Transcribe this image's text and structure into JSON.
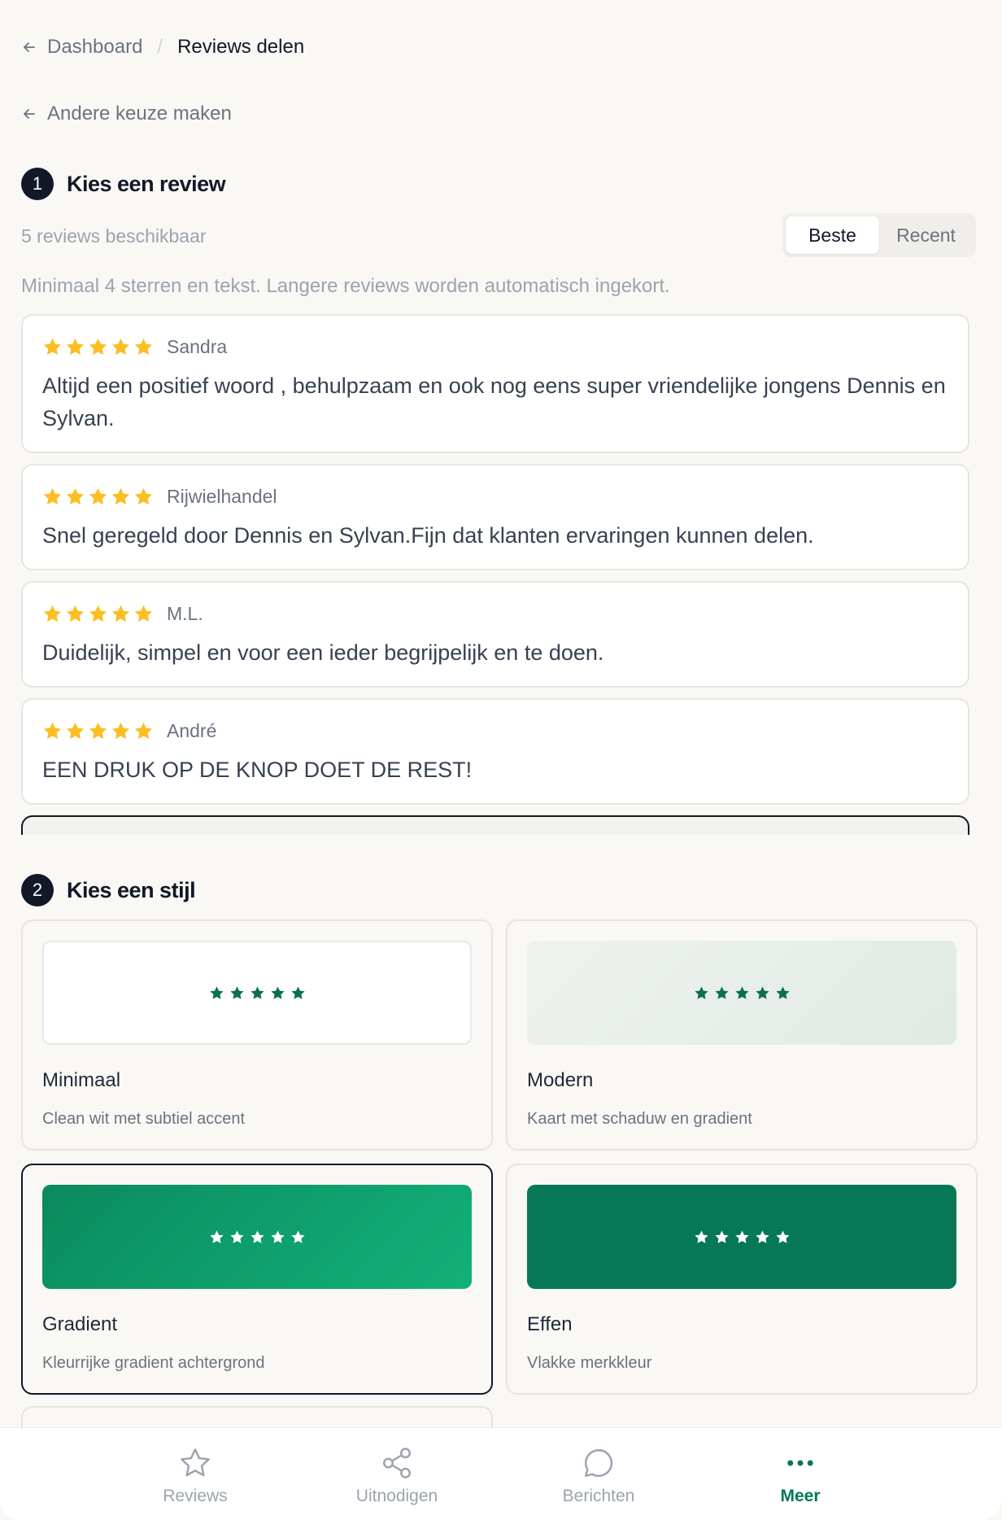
{
  "breadcrumb": {
    "back": "Dashboard",
    "separator": "/",
    "current": "Reviews delen"
  },
  "back_choice": "Andere keuze maken",
  "step1": {
    "number": "1",
    "title": "Kies een review"
  },
  "available": "5 reviews beschikbaar",
  "sort": {
    "options": [
      "Beste",
      "Recent"
    ],
    "active": "Beste"
  },
  "hint": "Minimaal 4 sterren en tekst. Langere reviews worden automatisch ingekort.",
  "reviews": [
    {
      "author": "Sandra",
      "rating": 5,
      "text": "Altijd een positief woord , behulpzaam en ook nog eens super vriendelijke jongens Dennis en Sylvan."
    },
    {
      "author": "Rijwielhandel",
      "rating": 5,
      "text": "Snel geregeld door Dennis en Sylvan.Fijn dat klanten ervaringen kunnen delen."
    },
    {
      "author": "M.L.",
      "rating": 5,
      "text": "Duidelijk, simpel en voor een ieder begrijpelijk en te doen."
    },
    {
      "author": "André",
      "rating": 5,
      "text": "EEN DRUK OP DE KNOP DOET DE REST!"
    }
  ],
  "step2": {
    "number": "2",
    "title": "Kies een stijl"
  },
  "styles": [
    {
      "name": "Minimaal",
      "desc": "Clean wit met subtiel accent"
    },
    {
      "name": "Modern",
      "desc": "Kaart met schaduw en gradient"
    },
    {
      "name": "Gradient",
      "desc": "Kleurrijke gradient achtergrond"
    },
    {
      "name": "Effen",
      "desc": "Vlakke merkkleur"
    }
  ],
  "selected_style": "Gradient",
  "nav": [
    {
      "label": "Reviews",
      "icon": "star-icon"
    },
    {
      "label": "Uitnodigen",
      "icon": "share-icon"
    },
    {
      "label": "Berichten",
      "icon": "chat-icon"
    },
    {
      "label": "Meer",
      "icon": "more-icon"
    }
  ],
  "active_nav": "Meer",
  "colors": {
    "star": "#fbbf24",
    "brand": "#047857",
    "brand_dark": "#077855",
    "gradient_start": "#0b8a5e",
    "gradient_end": "#12b17a"
  }
}
